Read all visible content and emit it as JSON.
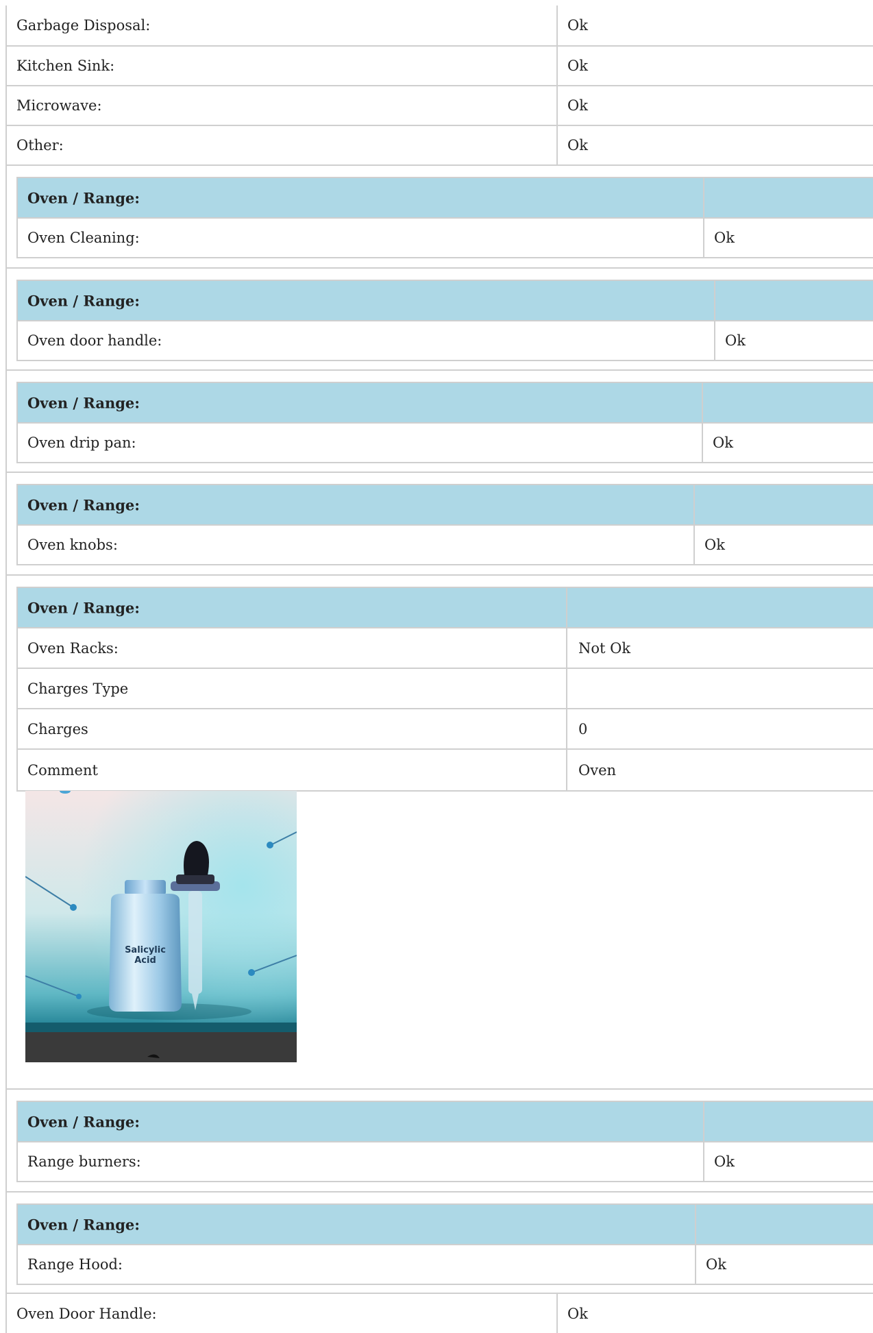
{
  "top_rows": [
    {
      "label": "Garbage Disposal:",
      "value": "Ok"
    },
    {
      "label": "Kitchen Sink:",
      "value": "Ok"
    },
    {
      "label": "Microwave:",
      "value": "Ok"
    },
    {
      "label": "Other:",
      "value": "Ok"
    }
  ],
  "sections": [
    {
      "title": "Oven / Range:",
      "rows": [
        {
          "label": "Oven Cleaning:",
          "value": "Ok"
        }
      ]
    },
    {
      "title": "Oven / Range:",
      "rows": [
        {
          "label": "Oven door handle:",
          "value": "Ok"
        }
      ]
    },
    {
      "title": "Oven / Range:",
      "rows": [
        {
          "label": "Oven drip pan:",
          "value": "Ok"
        }
      ]
    },
    {
      "title": "Oven / Range:",
      "rows": [
        {
          "label": "Oven knobs:",
          "value": "Ok"
        }
      ]
    },
    {
      "title": "Oven / Range:",
      "rows": [
        {
          "label": "Oven Racks:",
          "value": "Not Ok"
        },
        {
          "label": "Charges Type",
          "value": ""
        },
        {
          "label": "Charges",
          "value": "0"
        },
        {
          "label": "Comment",
          "value": "Oven"
        }
      ]
    },
    {
      "title": "Oven / Range:",
      "rows": [
        {
          "label": "Range burners:",
          "value": "Ok"
        }
      ]
    },
    {
      "title": "Oven / Range:",
      "rows": [
        {
          "label": "Range Hood:",
          "value": "Ok"
        }
      ]
    }
  ],
  "photo": {
    "bottle_text": [
      "Salicylic",
      "Acid"
    ]
  },
  "bottom_row": {
    "label": "Oven Door Handle:",
    "value": "Ok"
  }
}
